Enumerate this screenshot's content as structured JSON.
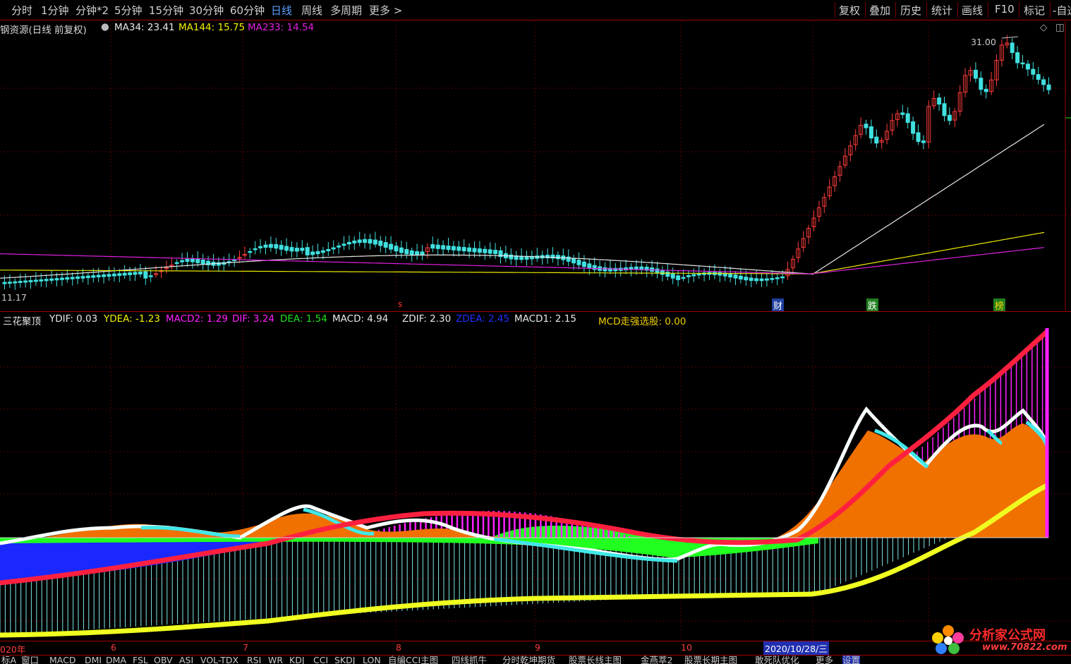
{
  "periods": [
    "分时",
    "1分钟",
    "分钟*2",
    "5分钟",
    "15分钟",
    "30分钟",
    "60分钟",
    "日线",
    "周线",
    "多周期",
    "更多 >"
  ],
  "active_period": "日线",
  "right_buttons": [
    "复权",
    "叠加",
    "历史",
    "统计",
    "画线",
    "F10",
    "标记",
    "-自选"
  ],
  "main_legend": {
    "stock": "钢资源(日线 前复权)",
    "ma34": "MA34: 23.41",
    "ma144": "MA144: 15.75",
    "ma233": "MA233: 14.54"
  },
  "price_labels": {
    "high": "31.00",
    "low": "11.17"
  },
  "markers": {
    "s": "s",
    "cai": "财",
    "die": "跌",
    "bang": "榜"
  },
  "indicator_legend": {
    "name": "三花聚顶",
    "ydif": "YDIF: 0.03",
    "ydea": "YDEA: -1.23",
    "macd2": "MACD2: 1.29",
    "dif": "DIF: 3.24",
    "dea": "DEA: 1.54",
    "macd": "MACD: 4.94",
    "zdif": "ZDIF: 2.30",
    "zdea": "ZDEA: 2.45",
    "macd1": "MACD1: 2.15",
    "mcd": "MCD走强选股: 0.00"
  },
  "date_axis": {
    "year": "020年",
    "m6": "6",
    "m7": "7",
    "m8": "8",
    "m9": "9",
    "m10": "10",
    "cursor": "2020/10/28/三"
  },
  "tabs": [
    "标A",
    "窗口",
    "MACD",
    "DMI",
    "DMA",
    "FSL",
    "OBV",
    "ASI",
    "VOL-TDX",
    "RSI",
    "WR",
    "KDJ",
    "CCI",
    "SKDJ",
    "LON",
    "自编CCI主图",
    "四线抓牛",
    "分时乾坤期货",
    "股票长线主图",
    "金燕萃2",
    "股票长期主图",
    "敢死队优化",
    "更多",
    "设置"
  ],
  "watermark": {
    "title": "分析家公式网",
    "url": "www.70822.com"
  },
  "colors": {
    "ma34": "#e8e8e8",
    "ma144": "#e8e800",
    "ma233": "#e020e0",
    "up": "#ff3c3c",
    "down": "#40e0e0",
    "grid": "#a00000"
  },
  "chart_data": {
    "type": "candlestick",
    "price_range": [
      11.17,
      31.0
    ],
    "x_months": [
      "6",
      "7",
      "8",
      "9",
      "10"
    ]
  }
}
